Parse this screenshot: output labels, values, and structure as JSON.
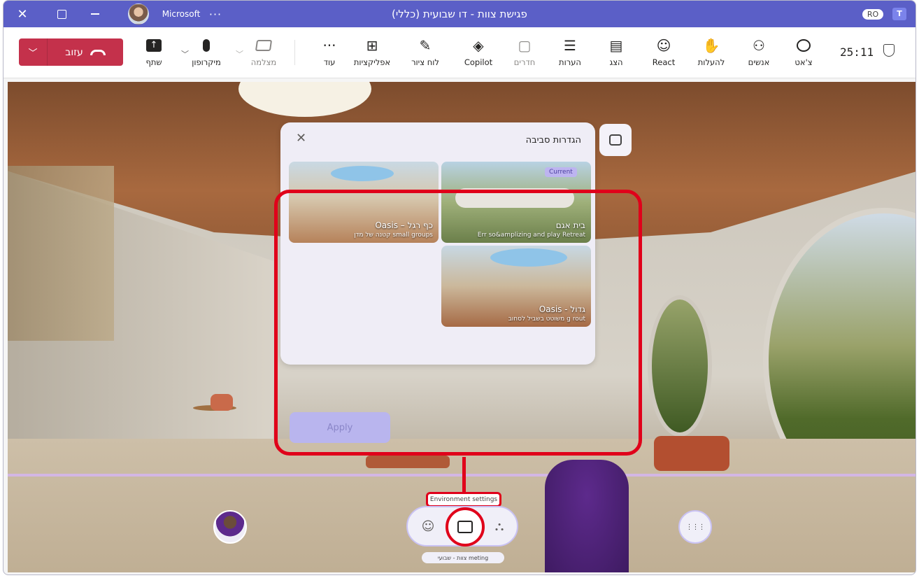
{
  "window": {
    "title": "פגישת צוות - דו שבועית (כללי)",
    "org": "Microsoft",
    "more": "···",
    "close_glyph": "✕",
    "badge": "RO",
    "app_icon": "T"
  },
  "toolbar": {
    "leave_label": "עזוב",
    "leave_dropdown": "﹀",
    "share": {
      "label": "שתף",
      "icon": "share-icon"
    },
    "mic": {
      "label": "מיקרופון",
      "icon": "microphone-icon"
    },
    "camera": {
      "label": "מצלמה",
      "icon": "camera-off-icon"
    },
    "more": {
      "label": "עוד",
      "glyph": "···"
    },
    "apps": {
      "label": "אפליקציות",
      "glyph": "⊞"
    },
    "whiteboard": {
      "label": "לוח ציור",
      "glyph": "✎"
    },
    "copilot": {
      "label": "Copilot",
      "glyph": "◈"
    },
    "rooms": {
      "label": "חדרים",
      "glyph": "▢"
    },
    "notes": {
      "label": "הערות",
      "glyph": "☰"
    },
    "present": {
      "label": "הצג",
      "glyph": "▤"
    },
    "react": {
      "label": "React",
      "glyph": "☺"
    },
    "raise": {
      "label": "להעלות",
      "glyph": "✋"
    },
    "people": {
      "label": "אנשים",
      "glyph": "⚇"
    },
    "chat": {
      "label": "צ'אט",
      "glyph": "💬"
    },
    "clock": "25:11"
  },
  "env_panel": {
    "title": "הגדרות סביבה",
    "close_glyph": "✕",
    "cards": [
      {
        "name": "בית אגם",
        "subtitle": "Err so&amplizing and play Retreat",
        "badge": "Current",
        "colors": [
          "#8fb3c9",
          "#6b7f4a"
        ]
      },
      {
        "name": "Oasis – כף רגל",
        "subtitle": "קטנה של מדן small groups",
        "badge": "",
        "colors": [
          "#a9c3d4",
          "#b6825a"
        ]
      },
      {
        "name": "Oasis - גדול",
        "subtitle": "משוטט בשביל לסחוב g rout",
        "badge": "",
        "colors": [
          "#9fc0d6",
          "#a66a45"
        ]
      }
    ],
    "apply_label": "Apply"
  },
  "tooltip": "Environment settings",
  "bottom": {
    "emoji_glyph": "☺",
    "env_icon": "environment-settings-icon",
    "avatar_glyph": "⛬",
    "grid_glyph": "⋮⋮⋮",
    "meeting_label": "צוות - שבועי meting"
  }
}
